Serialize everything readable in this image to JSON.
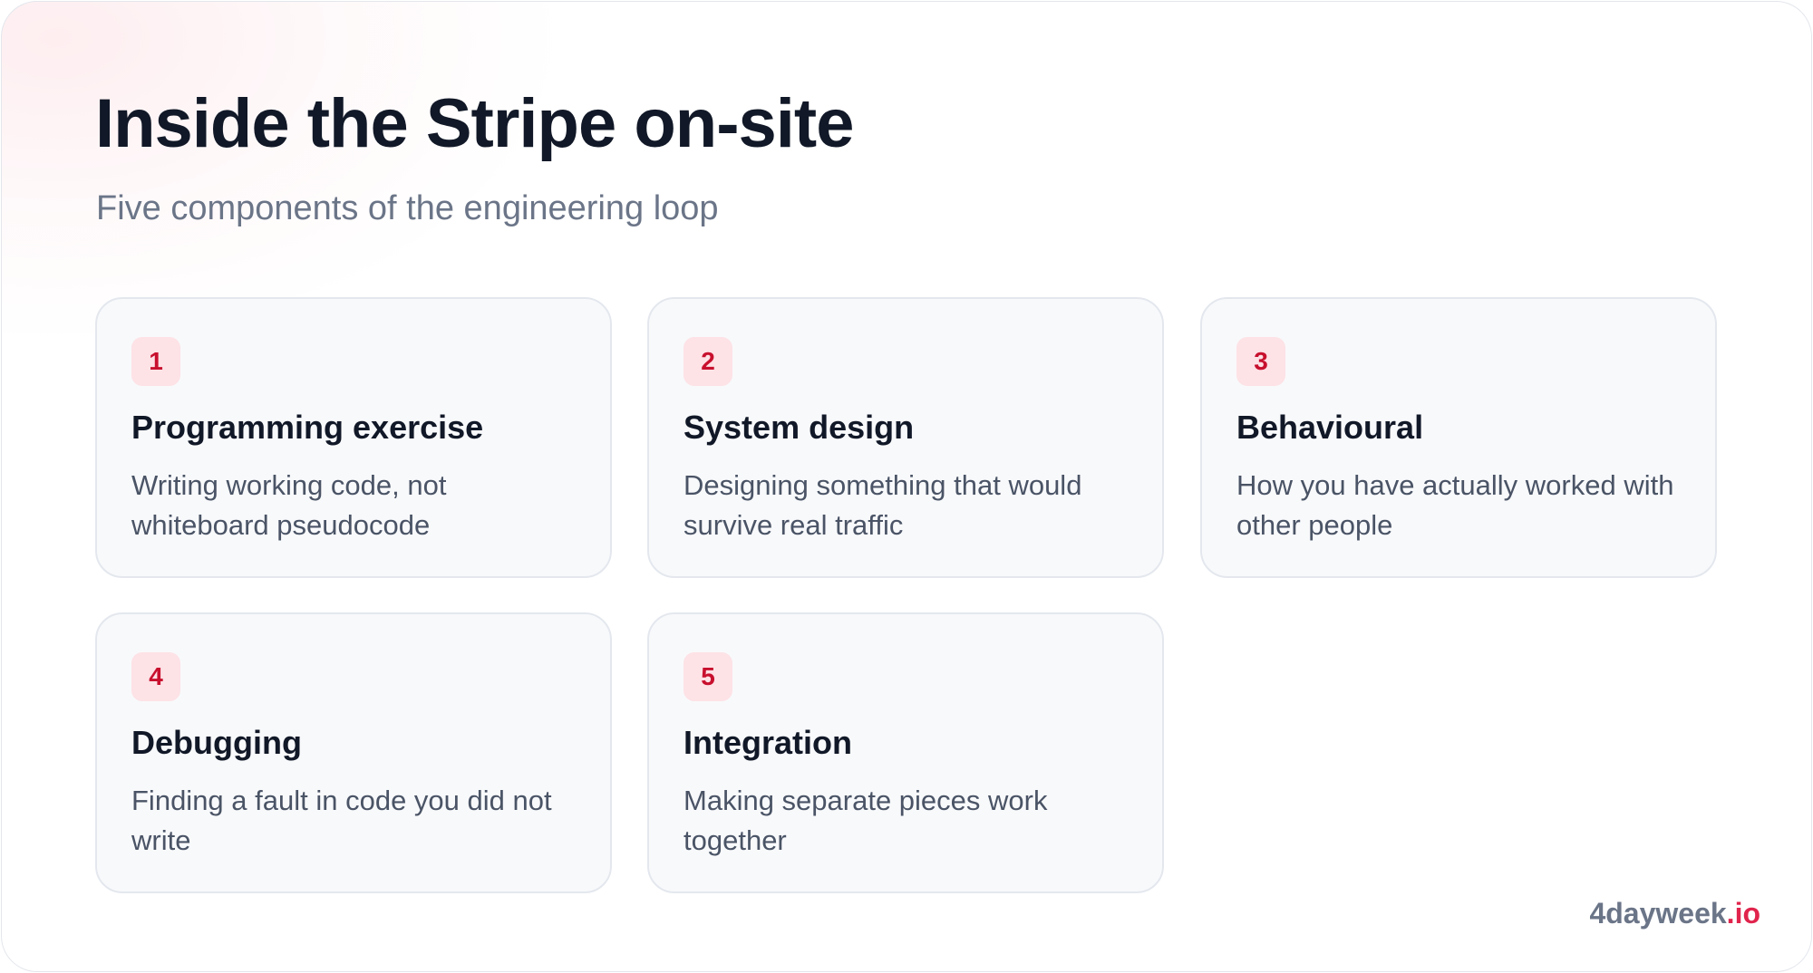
{
  "header": {
    "title": "Inside the Stripe on-site",
    "subtitle": "Five components of the engineering loop"
  },
  "cards": [
    {
      "number": "1",
      "title": "Programming exercise",
      "description": "Writing working code, not whiteboard pseudocode"
    },
    {
      "number": "2",
      "title": "System design",
      "description": "Designing something that would survive real traffic"
    },
    {
      "number": "3",
      "title": "Behavioural",
      "description": "How you have actually worked with other people"
    },
    {
      "number": "4",
      "title": "Debugging",
      "description": "Finding a fault in code you did not write"
    },
    {
      "number": "5",
      "title": "Integration",
      "description": "Making separate pieces work together"
    }
  ],
  "footer": {
    "brand_name": "4dayweek",
    "brand_suffix": ".io"
  },
  "colors": {
    "title": "#111827",
    "subtitle": "#6b7588",
    "badge_background": "#fde2e6",
    "badge_text": "#c8102e",
    "brand_accent": "#e0244c",
    "card_background": "#f8f9fb"
  }
}
